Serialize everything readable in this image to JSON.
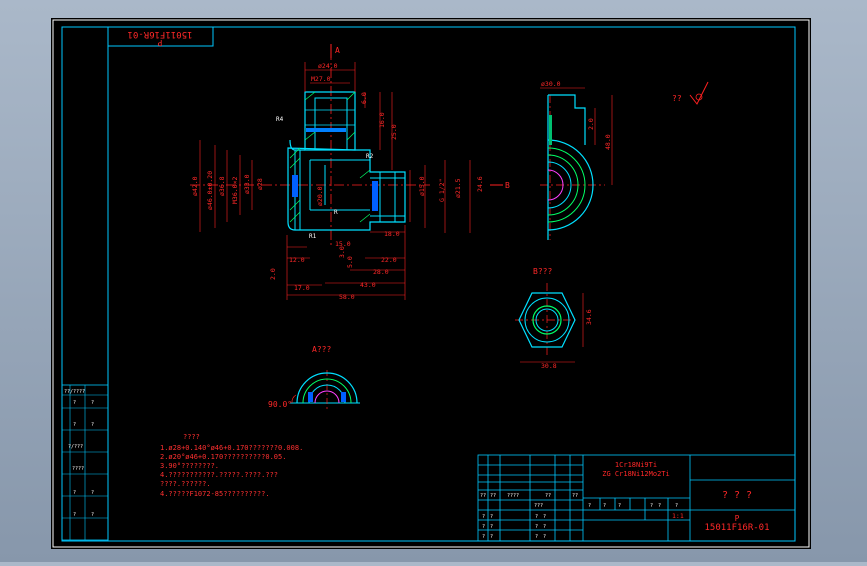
{
  "colors": {
    "background": "#000000",
    "frame": "#ffffff",
    "border": "#00c8ff",
    "outline": "#00e0ff",
    "dimension": "#ff2020",
    "text": "#ff2828",
    "centerline": "#ff2020",
    "hatch": "#00ff66",
    "note": "#ff3030",
    "block": "#00c8ff"
  },
  "drawing": {
    "code_rotated": "15011F16R-01",
    "code_prefix_rotated": "P",
    "view_a_marker": "A",
    "view_b_marker": "B",
    "roughness_mark": "??",
    "view_b_title": "B???",
    "view_a_title": "A???",
    "angle_label": "90.0°",
    "radius_label_r4": "R4",
    "radius_label_r2": "R2",
    "radius_label_r1": "R1",
    "leader_r": "R"
  },
  "dimensions": {
    "d24": "ø24.0",
    "d27": "M27.0",
    "h6": "6.0",
    "h16": "16.0",
    "h25": "25.0",
    "d42": "ø42.0",
    "d46": "ø46.0±0.20",
    "d36": "ø36.8",
    "d36_2": "M36.0×2",
    "d33": "ø33.0",
    "d28": "ø28",
    "d20": "ø20.0",
    "d15": "ø15.0",
    "d215": "ø21.5",
    "g12": "G 1/2\"",
    "h24": "24.6",
    "w12": "12.0",
    "w17": "17.0",
    "w58": "58.0",
    "w15": "15.0",
    "w28": "28.0",
    "w22": "22.0",
    "w43": "43.0",
    "w18": "18.0",
    "w3": "3.0",
    "w5": "5.0",
    "w2": "2.0",
    "side_d30": "ø30.0",
    "side_20": "2.0",
    "side_48": "48.0",
    "hex_30": "30.8",
    "hex_346": "34.6"
  },
  "notes": {
    "title": "????",
    "lines": [
      "1.ø28+0.140°ø46+0.170???????0.008.",
      "2.ø20°ø46+0.170??????????0.05.",
      "3.90°????????.",
      "4.???????????.?????.????.???",
      "  ????.??????.",
      "4.?????F1072-85??????????."
    ]
  },
  "left_table": {
    "rows": [
      [
        "??/????",
        "?",
        "?"
      ],
      [
        "?",
        "?",
        ""
      ],
      [
        "?",
        "?",
        "?"
      ],
      [
        "?/???",
        "",
        ""
      ],
      [
        "????",
        "",
        ""
      ],
      [
        "?",
        "?",
        "?"
      ],
      [
        "?",
        "?",
        "?"
      ]
    ]
  },
  "title_block": {
    "material_1": "1Cr18Ni9Ti",
    "material_2": "ZG Cr18Ni12Mo2Ti",
    "name": "? ? ?",
    "code_p": "P",
    "code": "15011F16R-01",
    "scale": "1:1",
    "label_cells": [
      "??",
      "??",
      "????",
      "??",
      "???",
      "??"
    ],
    "grid_marks": [
      "?",
      "?",
      "?",
      "?",
      "?",
      "?",
      "?",
      "?",
      "?",
      "?",
      "?",
      "?"
    ],
    "weight_header": [
      "?",
      "?",
      "?",
      "?",
      "?",
      "?"
    ]
  }
}
